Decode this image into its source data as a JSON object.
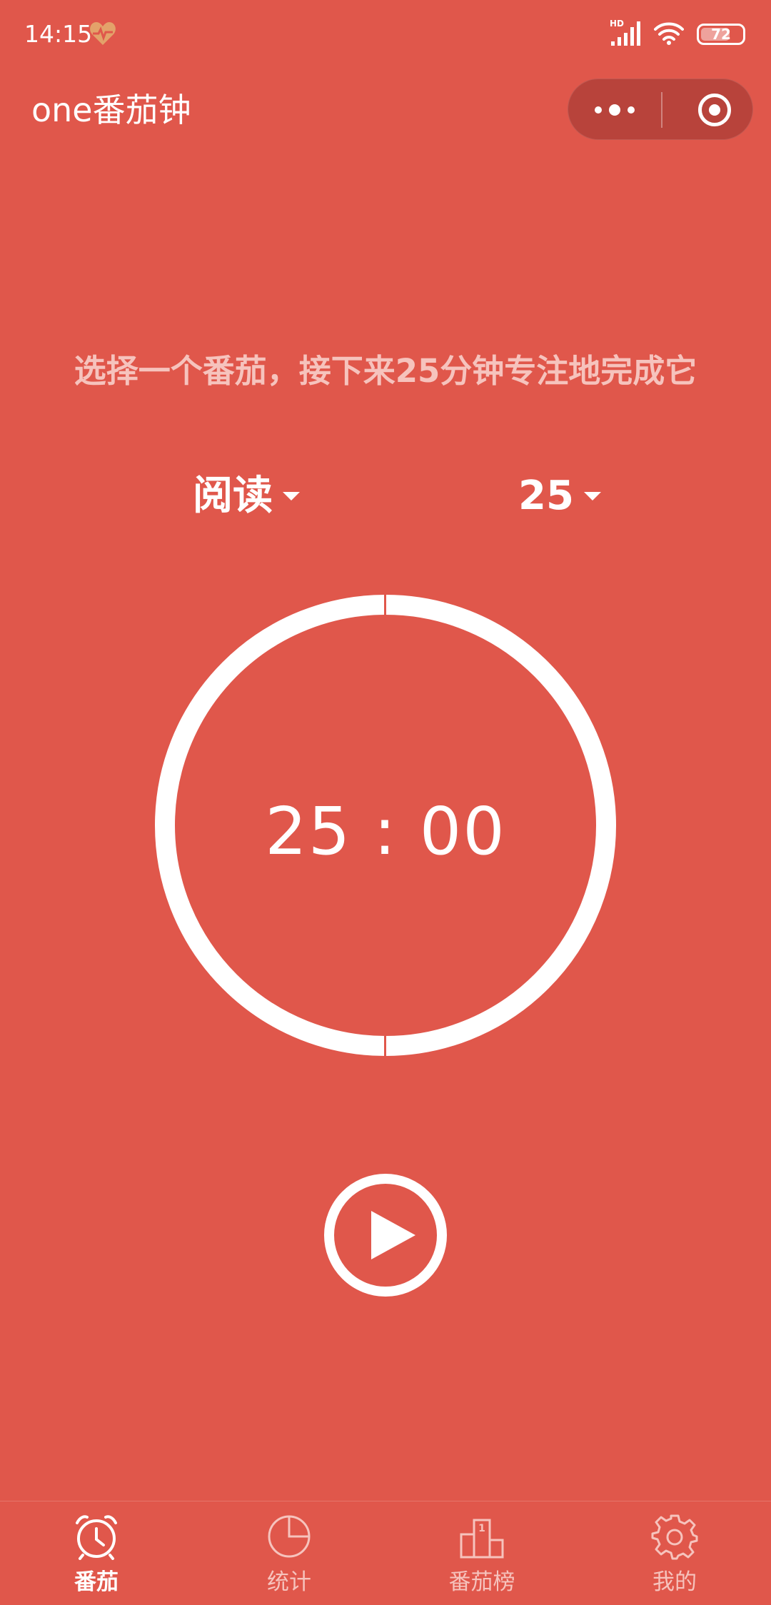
{
  "status_bar": {
    "time": "14:15",
    "network_label": "HD",
    "battery": 72
  },
  "header": {
    "title": "one番茄钟"
  },
  "main": {
    "instruction": "选择一个番茄，接下来25分钟专注地完成它",
    "task_picker": {
      "value": "阅读"
    },
    "minutes_picker": {
      "value": "25"
    },
    "timer": "25 : 00"
  },
  "tab_bar": {
    "tabs": [
      {
        "label": "番茄",
        "icon": "alarm-clock-icon",
        "active": true
      },
      {
        "label": "统计",
        "icon": "pie-chart-icon",
        "active": false
      },
      {
        "label": "番茄榜",
        "icon": "podium-icon",
        "active": false
      },
      {
        "label": "我的",
        "icon": "gear-icon",
        "active": false
      }
    ]
  },
  "colors": {
    "background": "#e0574b",
    "capsule": "#b8433b",
    "muted_text": "#f6c3bd",
    "heart": "#e3a26a"
  }
}
